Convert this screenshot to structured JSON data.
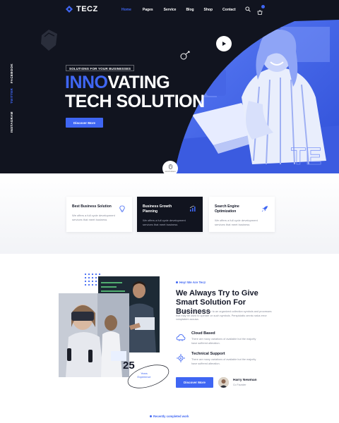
{
  "brand": {
    "name": "TECZ"
  },
  "nav": {
    "items": [
      {
        "label": "Home",
        "active": true
      },
      {
        "label": "Pages",
        "active": false
      },
      {
        "label": "Service",
        "active": false
      },
      {
        "label": "Blog",
        "active": false
      },
      {
        "label": "Shop",
        "active": false
      },
      {
        "label": "Contact",
        "active": false
      }
    ],
    "icons": [
      "search-icon",
      "cart-icon"
    ]
  },
  "social": [
    {
      "label": "FACEBOOK",
      "active": false
    },
    {
      "label": "TWITTER",
      "active": true
    },
    {
      "label": "INSTAGRAM",
      "active": false
    }
  ],
  "hero": {
    "badge": "SOLUTIONS FOR YOUR BUSINESSES",
    "title_accent": "INNO",
    "title_rest": "VATING",
    "title_line2": "TECH SOLUTION",
    "button": "Discover More",
    "scroll_label": "scroll down"
  },
  "services": [
    {
      "title": "Best Business Solution",
      "text": "We offers a full cycle development services that meet business",
      "icon": "lightbulb-icon",
      "dark": false
    },
    {
      "title": "Business Growth Planning",
      "text": "We offers a full cycle development services that meet business",
      "icon": "growth-chart-icon",
      "dark": true
    },
    {
      "title": "Search Engine Optimization",
      "text": "We offers a full cycle development services that meet business",
      "icon": "rocket-icon",
      "dark": false
    }
  ],
  "about": {
    "label": "Hey! We Are Tecz",
    "title": "We Always Try to Give Smart Solution For Business",
    "description": "System is a term used to refer to an organized collection symbols and processes that may be used to operate on such symbols. Perspiciatis omnis natus error voluptatem accusa.",
    "features": [
      {
        "title": "Cloud Based",
        "text": "There are many variations of available but the majority have suffered alteration.",
        "icon": "cloud-icon"
      },
      {
        "title": "Technical Support",
        "text": "There are many variations of available but the majority have suffered alteration.",
        "icon": "gear-network-icon"
      }
    ],
    "button": "Discover More",
    "author": {
      "name": "Harry Newman",
      "role": "Co Founder"
    },
    "years": {
      "number": "25",
      "label": "Years Experience"
    }
  },
  "recent": {
    "label": "Recently completed work"
  },
  "colors": {
    "accent": "#3f66f3",
    "dark": "#11141f"
  }
}
